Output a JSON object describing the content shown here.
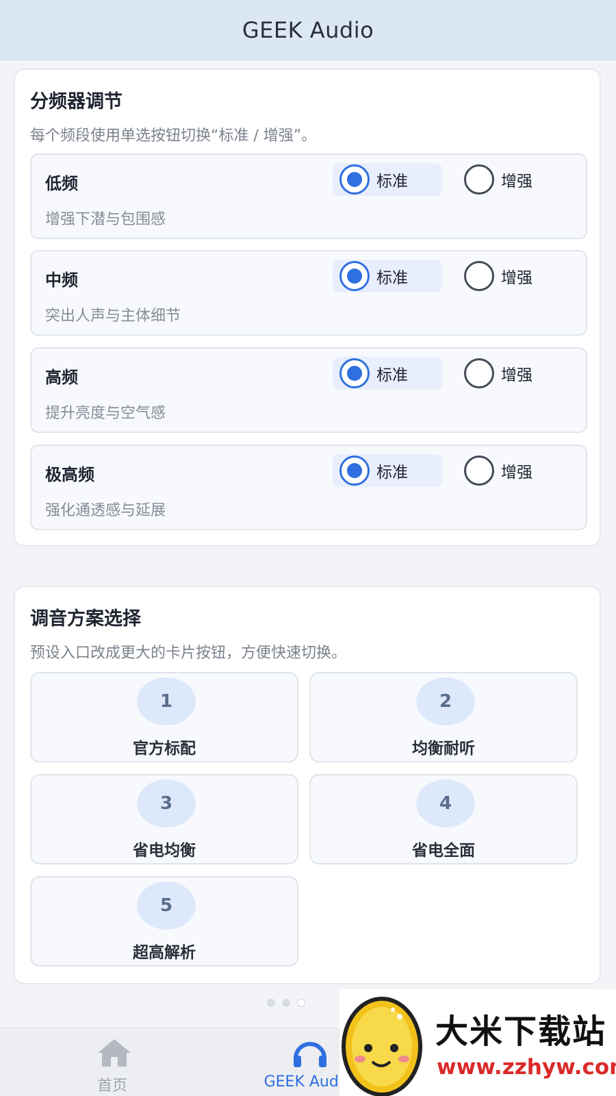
{
  "header": {
    "title": "GEEK Audio"
  },
  "crossover": {
    "title": "分频器调节",
    "description": "每个频段使用单选按钮切换“标准 / 增强”。",
    "bands": [
      {
        "name": "低频",
        "desc": "增强下潜与包围感",
        "standard_label": "标准",
        "enhance_label": "增强",
        "selected": "标准"
      },
      {
        "name": "中频",
        "desc": "突出人声与主体细节",
        "standard_label": "标准",
        "enhance_label": "增强",
        "selected": "标准"
      },
      {
        "name": "高频",
        "desc": "提升亮度与空气感",
        "standard_label": "标准",
        "enhance_label": "增强",
        "selected": "标准"
      },
      {
        "name": "极高频",
        "desc": "强化通透感与延展",
        "standard_label": "标准",
        "enhance_label": "增强",
        "selected": "标准"
      }
    ]
  },
  "presets": {
    "title": "调音方案选择",
    "description": "预设入口改成更大的卡片按钮，方便快速切换。",
    "items": [
      {
        "number": "1",
        "name": "官方标配"
      },
      {
        "number": "2",
        "name": "均衡耐听"
      },
      {
        "number": "3",
        "name": "省电均衡"
      },
      {
        "number": "4",
        "name": "省电全面"
      },
      {
        "number": "5",
        "name": "超高解析"
      }
    ]
  },
  "tabbar": {
    "home_label": "首页",
    "home_icon": "home-icon",
    "geek_label": "GEEK Audio",
    "geek_icon": "headphones-icon"
  },
  "watermark": {
    "title": "大米下载站",
    "url": "www.zzhyw.com"
  },
  "colors": {
    "accent": "#2f6fe0",
    "header_bg": "#dce7f6",
    "watermark_url": "#d92a2a"
  }
}
